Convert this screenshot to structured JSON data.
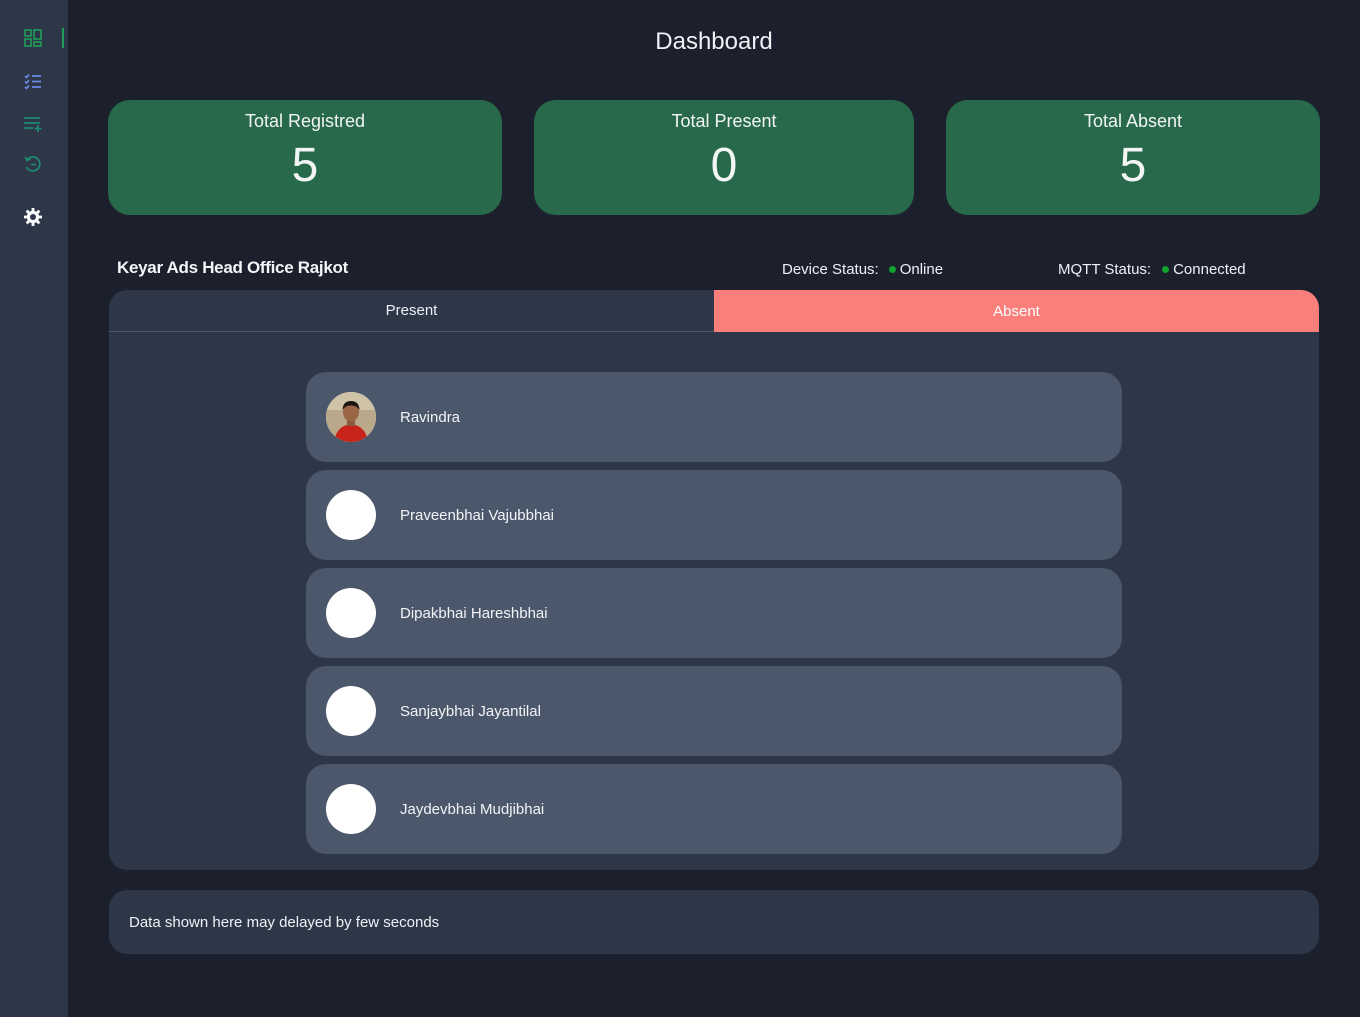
{
  "sidebar": {
    "items": [
      {
        "icon": "dashboard-icon"
      },
      {
        "icon": "checklist-icon"
      },
      {
        "icon": "add-list-icon"
      },
      {
        "icon": "history-icon"
      },
      {
        "icon": "settings-icon"
      }
    ],
    "accent_color": "#1f9e5a"
  },
  "page": {
    "title": "Dashboard"
  },
  "stats": {
    "registered": {
      "label": "Total Registred",
      "value": "5"
    },
    "present": {
      "label": "Total Present",
      "value": "0"
    },
    "absent": {
      "label": "Total Absent",
      "value": "5"
    }
  },
  "office": {
    "name": "Keyar Ads Head Office Rajkot"
  },
  "device_status": {
    "label": "Device Status:",
    "value": "Online",
    "color": "#11a12f"
  },
  "mqtt_status": {
    "label": "MQTT Status:",
    "value": "Connected",
    "color": "#11a12f"
  },
  "tabs": {
    "present": "Present",
    "absent": "Absent",
    "active": "absent",
    "active_color": "#fa7f7a"
  },
  "people": [
    {
      "name": "Ravindra",
      "has_photo": true
    },
    {
      "name": "Praveenbhai Vajubbhai",
      "has_photo": false
    },
    {
      "name": "Dipakbhai Hareshbhai",
      "has_photo": false
    },
    {
      "name": "Sanjaybhai Jayantilal",
      "has_photo": false
    },
    {
      "name": "Jaydevbhai Mudjibhai",
      "has_photo": false
    }
  ],
  "footer": {
    "note": "Data shown here may delayed by few seconds"
  }
}
